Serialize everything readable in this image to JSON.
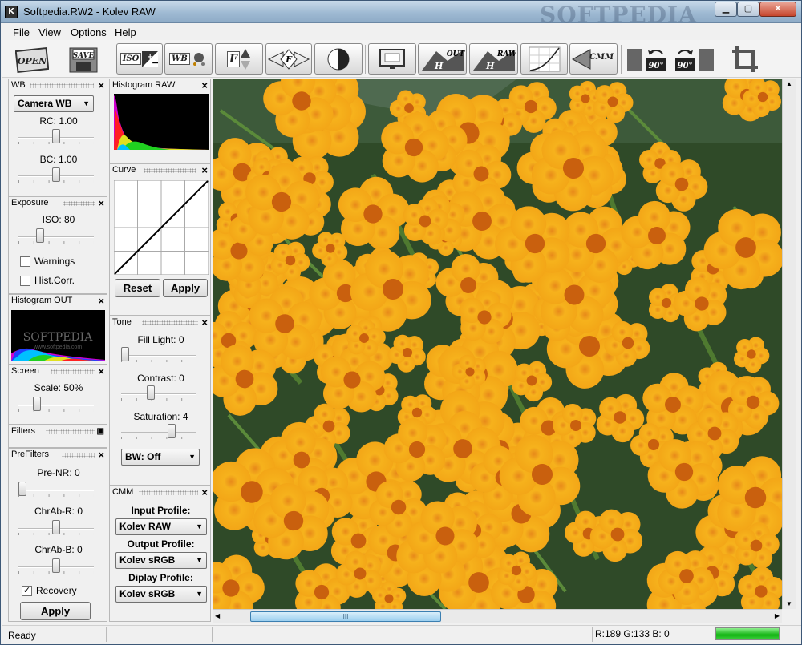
{
  "window": {
    "title": "Softpedia.RW2 - Kolev RAW",
    "watermark": "SOFTPEDIA",
    "app_icon": "K"
  },
  "caption_buttons": {
    "minimize": "▁",
    "maximize": "▢",
    "close": "✕"
  },
  "menu": [
    "File",
    "View",
    "Options",
    "Help"
  ],
  "toolbar": {
    "open": "OPEN",
    "save": "SAVE",
    "buttons": [
      {
        "name": "iso-exposure",
        "label": "ISO"
      },
      {
        "name": "white-balance",
        "label": "WB"
      },
      {
        "name": "filters",
        "label": "F"
      },
      {
        "name": "prefilters",
        "label": "F"
      },
      {
        "name": "tone",
        "label": ""
      },
      {
        "name": "screen",
        "label": ""
      },
      {
        "name": "histogram-out",
        "label": "OUT"
      },
      {
        "name": "histogram-raw",
        "label": "RAW"
      },
      {
        "name": "curve",
        "label": ""
      },
      {
        "name": "cmm",
        "label": "CMM"
      }
    ],
    "rotate_ccw": "90°",
    "rotate_cw": "90°"
  },
  "wb_panel": {
    "title": "WB",
    "mode": "Camera WB",
    "rc_label": "RC: 1.00",
    "rc_value": 1.0,
    "bc_label": "BC: 1.00",
    "bc_value": 1.0
  },
  "exposure_panel": {
    "title": "Exposure",
    "iso_label": "ISO: 80",
    "warnings_label": "Warnings",
    "warnings_checked": false,
    "histcorr_label": "Hist.Corr.",
    "histcorr_checked": false
  },
  "histogram_out_panel": {
    "title": "Histogram OUT",
    "watermark": "SOFTPEDIA",
    "watermark_url": "www.softpedia.com"
  },
  "screen_panel": {
    "title": "Screen",
    "scale_label": "Scale: 50%",
    "scale_value": 50
  },
  "filters_panel": {
    "title": "Filters"
  },
  "prefilters_panel": {
    "title": "PreFilters",
    "prenr_label": "Pre-NR: 0",
    "chrabr_label": "ChrAb-R: 0",
    "chrabb_label": "ChrAb-B: 0",
    "recovery_label": "Recovery",
    "recovery_checked": true,
    "apply_label": "Apply"
  },
  "histogram_raw_panel": {
    "title": "Histogram RAW"
  },
  "curve_panel": {
    "title": "Curve",
    "reset_label": "Reset",
    "apply_label": "Apply"
  },
  "tone_panel": {
    "title": "Tone",
    "filllight_label": "Fill Light: 0",
    "contrast_label": "Contrast: 0",
    "saturation_label": "Saturation: 4",
    "bw_value": "BW: Off"
  },
  "cmm_panel": {
    "title": "CMM",
    "input_label": "Input Profile:",
    "input_value": "Kolev RAW",
    "output_label": "Output Profile:",
    "output_value": "Kolev sRGB",
    "display_label": "Diplay Profile:",
    "display_value": "Kolev sRGB"
  },
  "status": {
    "text": "Ready",
    "rgb": "R:189 G:133 B:  0",
    "progress": 1.0
  },
  "colors": {
    "accent_green": "#12b312",
    "flower": "#f2a81a",
    "foliage": "#2e4a2a"
  },
  "image": {
    "description_icon": "marigold-flowers-photo"
  },
  "scroll": {
    "hthumb_grip": "III"
  }
}
